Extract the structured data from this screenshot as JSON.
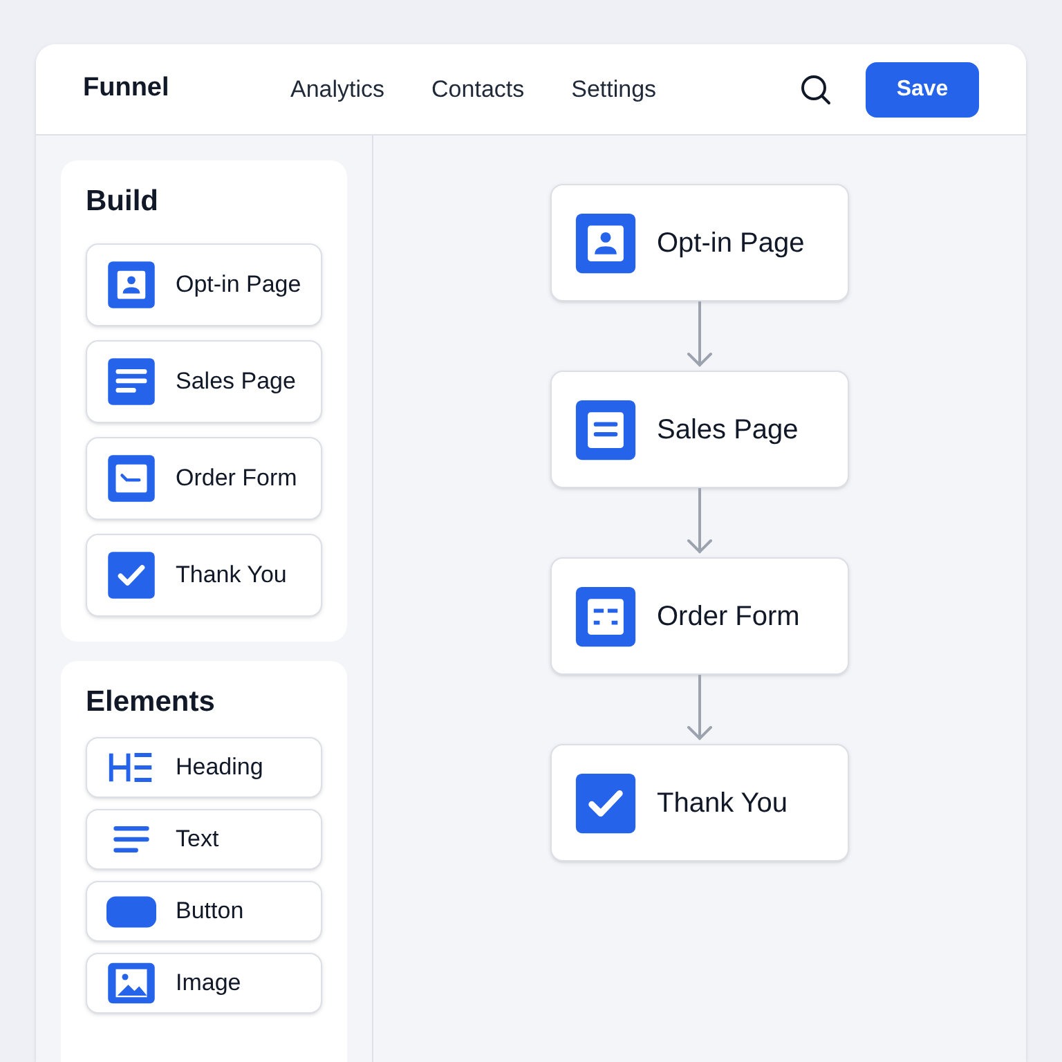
{
  "header": {
    "logo": "Funnel",
    "nav": [
      "Analytics",
      "Contacts",
      "Settings"
    ],
    "save_button": "Save"
  },
  "sidebar": {
    "build": {
      "title": "Build",
      "items": [
        {
          "label": "Opt-in Page",
          "kind": "person"
        },
        {
          "label": "Sales Page",
          "kind": "lines"
        },
        {
          "label": "Order Form",
          "kind": "form"
        },
        {
          "label": "Thank You",
          "kind": "check"
        }
      ]
    },
    "elements": {
      "title": "Elements",
      "items": [
        {
          "label": "Heading",
          "kind": "heading"
        },
        {
          "label": "Text",
          "kind": "text"
        },
        {
          "label": "Button",
          "kind": "button"
        },
        {
          "label": "Image",
          "kind": "image"
        }
      ]
    }
  },
  "flow": {
    "nodes": [
      {
        "label": "Opt-in Page",
        "kind": "person"
      },
      {
        "label": "Sales Page",
        "kind": "lines2"
      },
      {
        "label": "Order Form",
        "kind": "form2"
      },
      {
        "label": "Thank You",
        "kind": "check"
      }
    ]
  }
}
